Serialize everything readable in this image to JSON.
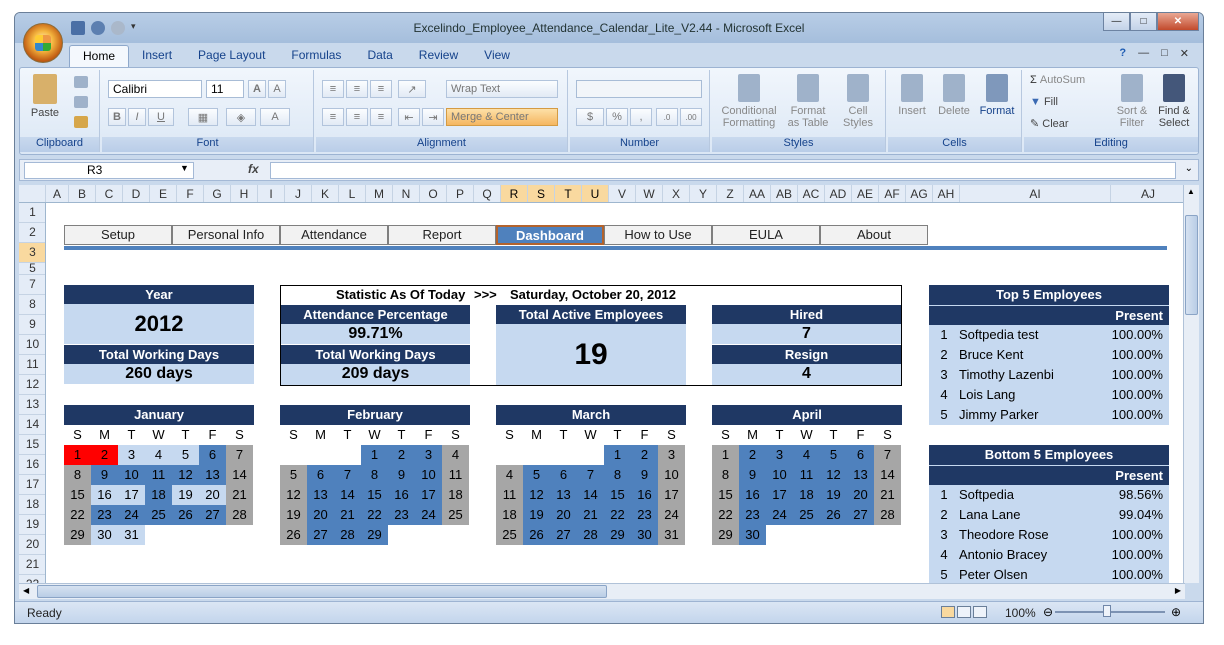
{
  "window": {
    "title": "Excelindo_Employee_Attendance_Calendar_Lite_V2.44 - Microsoft Excel"
  },
  "ribbon": {
    "tabs": [
      "Home",
      "Insert",
      "Page Layout",
      "Formulas",
      "Data",
      "Review",
      "View"
    ],
    "active_tab": "Home",
    "clipboard": {
      "paste": "Paste",
      "group": "Clipboard"
    },
    "font": {
      "name": "Calibri",
      "size": "11",
      "group": "Font"
    },
    "alignment": {
      "wrap": "Wrap Text",
      "merge": "Merge & Center",
      "group": "Alignment"
    },
    "number": {
      "currency": "$",
      "percent": "%",
      "comma": ",",
      "group": "Number"
    },
    "styles": {
      "conditional": "Conditional",
      "conditional2": "Formatting",
      "format_table": "Format",
      "format_table2": "as Table",
      "cell_styles": "Cell",
      "cell_styles2": "Styles",
      "group": "Styles"
    },
    "cells": {
      "insert": "Insert",
      "delete": "Delete",
      "format": "Format",
      "group": "Cells"
    },
    "editing": {
      "autosum": "AutoSum",
      "fill": "Fill",
      "clear": "Clear",
      "sort": "Sort &",
      "sort2": "Filter",
      "find": "Find &",
      "find2": "Select",
      "group": "Editing"
    }
  },
  "formula_bar": {
    "name_box": "R3",
    "fx": "fx",
    "value": ""
  },
  "columns": [
    "A",
    "B",
    "C",
    "D",
    "E",
    "F",
    "G",
    "H",
    "I",
    "J",
    "K",
    "L",
    "M",
    "N",
    "O",
    "P",
    "Q",
    "R",
    "S",
    "T",
    "U",
    "V",
    "W",
    "X",
    "Y",
    "Z",
    "AA",
    "AB",
    "AC",
    "AD",
    "AE",
    "AF",
    "AG",
    "AH",
    "AI",
    "AJ"
  ],
  "rows": [
    "1",
    "2",
    "3",
    "5",
    "7",
    "8",
    "9",
    "10",
    "11",
    "12",
    "13",
    "14",
    "15",
    "16",
    "17",
    "18",
    "19",
    "20",
    "21",
    "22"
  ],
  "nav": [
    "Setup",
    "Personal Info",
    "Attendance",
    "Report",
    "Dashboard",
    "How to Use",
    "EULA",
    "About"
  ],
  "nav_active": "Dashboard",
  "dashboard": {
    "year_label": "Year",
    "year": "2012",
    "twd_label": "Total Working Days",
    "twd": "260 days",
    "statistic_label": "Statistic As Of Today",
    "arrows": ">>>",
    "today": "Saturday, October 20, 2012",
    "att_pct_label": "Attendance Percentage",
    "att_pct": "99.71%",
    "twd2_label": "Total Working Days",
    "twd2": "209 days",
    "active_label": "Total Active Employees",
    "active": "19",
    "hired_label": "Hired",
    "hired": "7",
    "resign_label": "Resign",
    "resign": "4"
  },
  "calendars": [
    {
      "month": "January",
      "days": [
        "S",
        "M",
        "T",
        "W",
        "T",
        "F",
        "S"
      ],
      "weeks": [
        [
          "1",
          "2",
          "3",
          "4",
          "5",
          "6",
          "7"
        ],
        [
          "8",
          "9",
          "10",
          "11",
          "12",
          "13",
          "14"
        ],
        [
          "15",
          "16",
          "17",
          "18",
          "19",
          "20",
          "21"
        ],
        [
          "22",
          "23",
          "24",
          "25",
          "26",
          "27",
          "28"
        ],
        [
          "29",
          "30",
          "31",
          "",
          "",
          "",
          ""
        ]
      ],
      "style": [
        [
          "red",
          "red",
          "pale",
          "pale",
          "pale",
          "wd",
          "we"
        ],
        [
          "we",
          "wd",
          "wd",
          "wd",
          "wd",
          "wd",
          "we"
        ],
        [
          "we",
          "pale",
          "pale",
          "wd",
          "pale",
          "pale",
          "we"
        ],
        [
          "we",
          "wd",
          "wd",
          "wd",
          "wd",
          "wd",
          "we"
        ],
        [
          "we",
          "pale",
          "pale",
          "none",
          "none",
          "none",
          "none"
        ]
      ]
    },
    {
      "month": "February",
      "days": [
        "S",
        "M",
        "T",
        "W",
        "T",
        "F",
        "S"
      ],
      "weeks": [
        [
          "",
          "",
          "",
          "1",
          "2",
          "3",
          "4"
        ],
        [
          "5",
          "6",
          "7",
          "8",
          "9",
          "10",
          "11"
        ],
        [
          "12",
          "13",
          "14",
          "15",
          "16",
          "17",
          "18"
        ],
        [
          "19",
          "20",
          "21",
          "22",
          "23",
          "24",
          "25"
        ],
        [
          "26",
          "27",
          "28",
          "29",
          "",
          "",
          ""
        ]
      ],
      "style": [
        [
          "none",
          "none",
          "none",
          "wd",
          "wd",
          "wd",
          "we"
        ],
        [
          "we",
          "wd",
          "wd",
          "wd",
          "wd",
          "wd",
          "we"
        ],
        [
          "we",
          "wd",
          "wd",
          "wd",
          "wd",
          "wd",
          "we"
        ],
        [
          "we",
          "wd",
          "wd",
          "wd",
          "wd",
          "wd",
          "we"
        ],
        [
          "we",
          "wd",
          "wd",
          "wd",
          "none",
          "none",
          "none"
        ]
      ]
    },
    {
      "month": "March",
      "days": [
        "S",
        "M",
        "T",
        "W",
        "T",
        "F",
        "S"
      ],
      "weeks": [
        [
          "",
          "",
          "",
          "",
          "1",
          "2",
          "3"
        ],
        [
          "4",
          "5",
          "6",
          "7",
          "8",
          "9",
          "10"
        ],
        [
          "11",
          "12",
          "13",
          "14",
          "15",
          "16",
          "17"
        ],
        [
          "18",
          "19",
          "20",
          "21",
          "22",
          "23",
          "24"
        ],
        [
          "25",
          "26",
          "27",
          "28",
          "29",
          "30",
          "31"
        ]
      ],
      "style": [
        [
          "none",
          "none",
          "none",
          "none",
          "wd",
          "wd",
          "we"
        ],
        [
          "we",
          "wd",
          "wd",
          "wd",
          "wd",
          "wd",
          "we"
        ],
        [
          "we",
          "wd",
          "wd",
          "wd",
          "wd",
          "wd",
          "we"
        ],
        [
          "we",
          "wd",
          "wd",
          "wd",
          "wd",
          "wd",
          "we"
        ],
        [
          "we",
          "wd",
          "wd",
          "wd",
          "wd",
          "wd",
          "we"
        ]
      ]
    },
    {
      "month": "April",
      "days": [
        "S",
        "M",
        "T",
        "W",
        "T",
        "F",
        "S"
      ],
      "weeks": [
        [
          "1",
          "2",
          "3",
          "4",
          "5",
          "6",
          "7"
        ],
        [
          "8",
          "9",
          "10",
          "11",
          "12",
          "13",
          "14"
        ],
        [
          "15",
          "16",
          "17",
          "18",
          "19",
          "20",
          "21"
        ],
        [
          "22",
          "23",
          "24",
          "25",
          "26",
          "27",
          "28"
        ],
        [
          "29",
          "30",
          "",
          "",
          "",
          "",
          ""
        ]
      ],
      "style": [
        [
          "we",
          "wd",
          "wd",
          "wd",
          "wd",
          "wd",
          "we"
        ],
        [
          "we",
          "wd",
          "wd",
          "wd",
          "wd",
          "wd",
          "we"
        ],
        [
          "we",
          "wd",
          "wd",
          "wd",
          "wd",
          "wd",
          "we"
        ],
        [
          "we",
          "wd",
          "wd",
          "wd",
          "wd",
          "wd",
          "we"
        ],
        [
          "we",
          "wd",
          "none",
          "none",
          "none",
          "none",
          "none"
        ]
      ]
    }
  ],
  "top5": {
    "title": "Top 5 Employees",
    "col": "Present",
    "rows": [
      [
        "1",
        "Softpedia test",
        "100.00%"
      ],
      [
        "2",
        "Bruce Kent",
        "100.00%"
      ],
      [
        "3",
        "Timothy Lazenbi",
        "100.00%"
      ],
      [
        "4",
        "Lois Lang",
        "100.00%"
      ],
      [
        "5",
        "Jimmy Parker",
        "100.00%"
      ]
    ]
  },
  "bottom5": {
    "title": "Bottom 5 Employees",
    "col": "Present",
    "rows": [
      [
        "1",
        "Softpedia",
        "98.56%"
      ],
      [
        "2",
        "Lana Lane",
        "99.04%"
      ],
      [
        "3",
        "Theodore Rose",
        "100.00%"
      ],
      [
        "4",
        "Antonio Bracey",
        "100.00%"
      ],
      [
        "5",
        "Peter Olsen",
        "100.00%"
      ]
    ]
  },
  "status": {
    "ready": "Ready",
    "zoom": "100%"
  },
  "colors": {
    "navy": "#1f3864",
    "blue": "#4f81bd",
    "pale": "#c6d9f0",
    "weekend": "#a6a6a6",
    "holiday": "#ff0000"
  }
}
